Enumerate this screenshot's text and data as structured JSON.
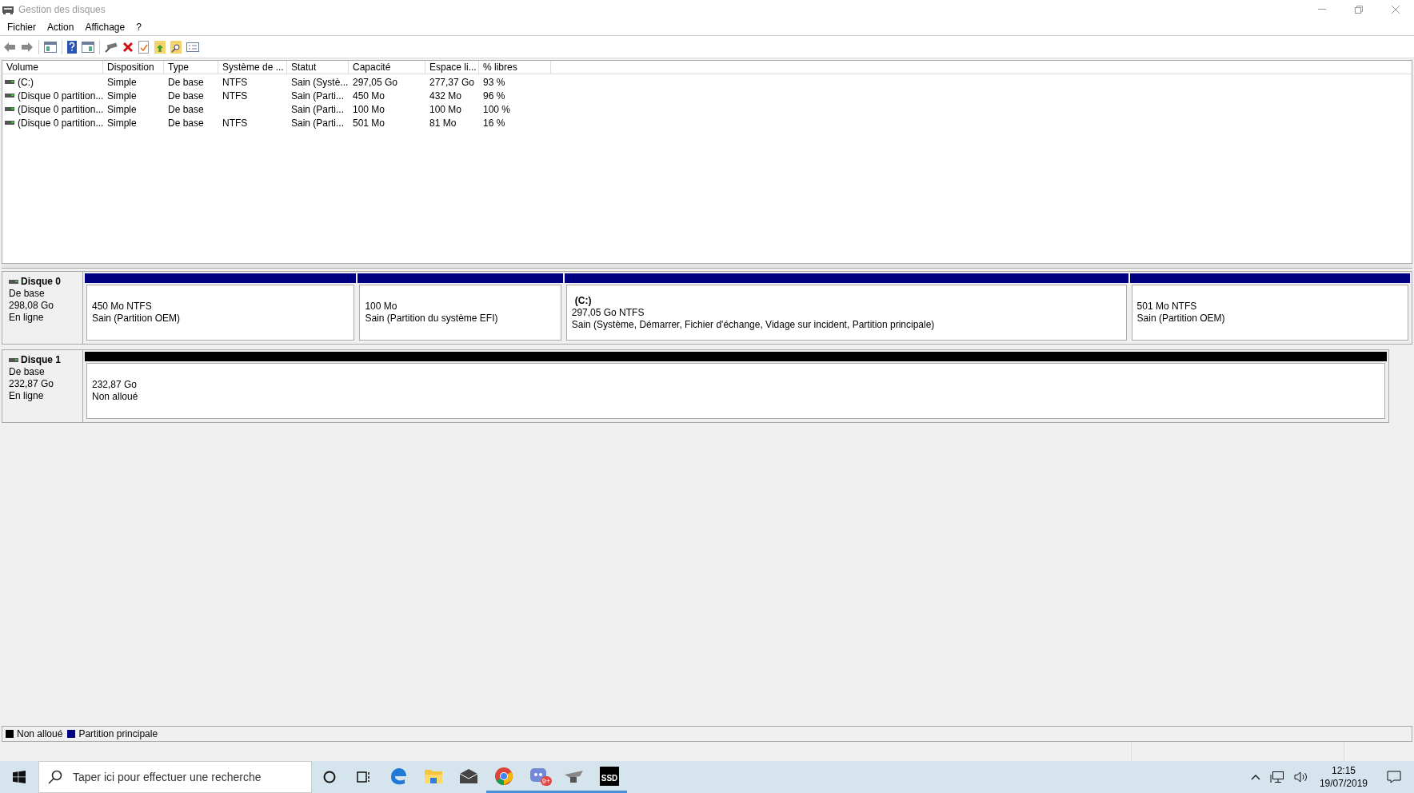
{
  "window": {
    "title": "Gestion des disques"
  },
  "menu": [
    "Fichier",
    "Action",
    "Affichage",
    "?"
  ],
  "table": {
    "columns": [
      "Volume",
      "Disposition",
      "Type",
      "Système de ...",
      "Statut",
      "Capacité",
      "Espace li...",
      "% libres"
    ],
    "rows": [
      [
        "(C:)",
        "Simple",
        "De base",
        "NTFS",
        "Sain (Systè...",
        "297,05 Go",
        "277,37 Go",
        "93 %"
      ],
      [
        "(Disque 0 partition...",
        "Simple",
        "De base",
        "NTFS",
        "Sain (Parti...",
        "450 Mo",
        "432 Mo",
        "96 %"
      ],
      [
        "(Disque 0 partition...",
        "Simple",
        "De base",
        "",
        "Sain (Parti...",
        "100 Mo",
        "100 Mo",
        "100 %"
      ],
      [
        "(Disque 0 partition...",
        "Simple",
        "De base",
        "NTFS",
        "Sain (Parti...",
        "501 Mo",
        "81 Mo",
        "16 %"
      ]
    ]
  },
  "disks": [
    {
      "name": "Disque 0",
      "type": "De base",
      "size": "298,08 Go",
      "state": "En ligne",
      "partitions": [
        {
          "size": "450 Mo NTFS",
          "status": "Sain (Partition OEM)",
          "color": "#000080"
        },
        {
          "size": "100 Mo",
          "status": "Sain (Partition du système EFI)",
          "color": "#000080"
        },
        {
          "label": "(C:)",
          "size": "297,05 Go NTFS",
          "status": "Sain (Système, Démarrer, Fichier d'échange, Vidage sur incident, Partition principale)",
          "color": "#000080"
        },
        {
          "size": "501 Mo NTFS",
          "status": "Sain (Partition OEM)",
          "color": "#000080"
        }
      ]
    },
    {
      "name": "Disque 1",
      "type": "De base",
      "size": "232,87 Go",
      "state": "En ligne",
      "partitions": [
        {
          "size": "232,87 Go",
          "status": "Non alloué",
          "color": "#000000"
        }
      ]
    }
  ],
  "legend": [
    {
      "label": "Non alloué",
      "color": "#000000"
    },
    {
      "label": "Partition principale",
      "color": "#000080"
    }
  ],
  "taskbar": {
    "search": {
      "placeholder": "Taper ici pour effectuer une recherche"
    },
    "apps": [
      {
        "kind": "edge",
        "running": false
      },
      {
        "kind": "folder",
        "running": false
      },
      {
        "kind": "mail",
        "running": false
      },
      {
        "kind": "chrome",
        "running": true
      },
      {
        "kind": "chat",
        "running": true,
        "badge": "9+"
      },
      {
        "kind": "tool",
        "running": true
      },
      {
        "kind": "ssd",
        "running": true,
        "label": "SSD"
      }
    ],
    "time": "12:15",
    "date": "19/07/2019"
  }
}
